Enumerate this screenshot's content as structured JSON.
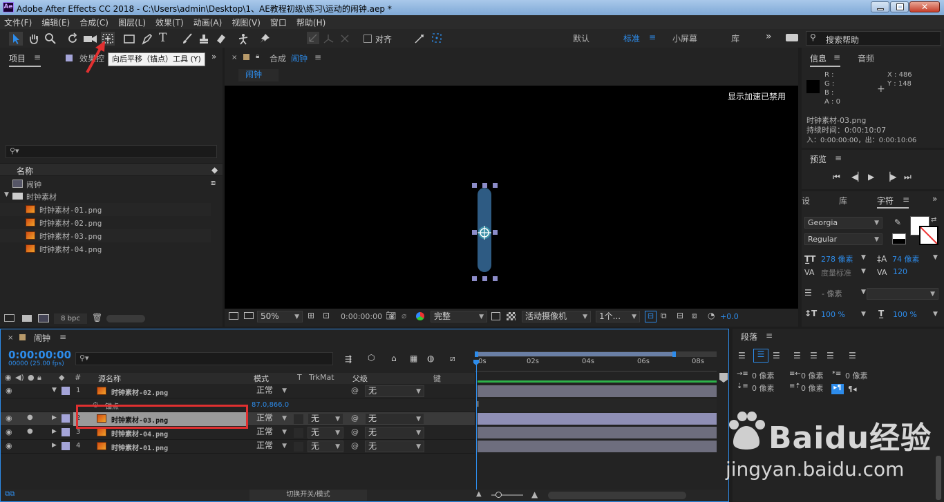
{
  "window": {
    "title": "Adobe After Effects CC 2018 - C:\\Users\\admin\\Desktop\\1、AE教程初级\\练习\\运动的闹钟.aep *",
    "app_icon": "Ae"
  },
  "menu": [
    "文件(F)",
    "编辑(E)",
    "合成(C)",
    "图层(L)",
    "效果(T)",
    "动画(A)",
    "视图(V)",
    "窗口",
    "帮助(H)"
  ],
  "toolbar": {
    "tooltip": "向后平移（锚点）工具 (Y)",
    "align_label": "对齐",
    "workspaces": [
      "默认",
      "标准",
      "小屏幕",
      "库"
    ],
    "search_placeholder": "搜索帮助"
  },
  "project": {
    "tab_project": "项目",
    "tab_effects": "效果控",
    "col_name": "名称",
    "items": [
      {
        "name": "闹钟",
        "type": "comp"
      },
      {
        "name": "时钟素材",
        "type": "folder"
      },
      {
        "name": "时钟素材-01.png",
        "type": "image"
      },
      {
        "name": "时钟素材-02.png",
        "type": "image"
      },
      {
        "name": "时钟素材-03.png",
        "type": "image"
      },
      {
        "name": "时钟素材-04.png",
        "type": "image"
      }
    ],
    "bpc": "8 bpc"
  },
  "comp": {
    "tab_prefix": "合成",
    "name": "闹钟",
    "breadcrumb": "闹钟",
    "accel_notice": "显示加速已禁用",
    "zoom": "50%",
    "timecode": "0:00:00:00",
    "quality": "完整",
    "camera": "活动摄像机",
    "views": "1个...",
    "exposure": "+0.0"
  },
  "info": {
    "tab_info": "信息",
    "tab_audio": "音频",
    "r": "R :",
    "g": "G :",
    "b": "B :",
    "a": "A : 0",
    "x": "X : 486",
    "y": "Y : 148",
    "file": "时钟素材-03.png",
    "duration": "持续时间：0:00:10:07",
    "inout": "入：0:00:00:00，出：0:00:10:06"
  },
  "preview": {
    "title": "预览"
  },
  "character": {
    "tab_settings": "设",
    "tab_library": "库",
    "tab_char": "字符",
    "font": "Georgia",
    "style": "Regular",
    "size": "278 像素",
    "leading": "74 像素",
    "kerning": "度量标准",
    "tracking": "120",
    "stroke_width": "- 像素",
    "vscale": "100 %",
    "hscale": "100 %"
  },
  "paragraph": {
    "title": "段落",
    "indent_left": "0 像素",
    "indent_first": "0 像素",
    "indent_right": "0 像素",
    "space_before": "0 像素",
    "space_after": "0 像素"
  },
  "timeline": {
    "comp_name": "闹钟",
    "timecode": "0:00:00:00",
    "fps": "00000 (25.00 fps)",
    "headers": {
      "num": "#",
      "source": "源名称",
      "mode": "模式",
      "t": "T",
      "trkmat": "TrkMat",
      "parent": "父级",
      "keys": "键"
    },
    "ruler": [
      "0s",
      "02s",
      "04s",
      "06s",
      "08s"
    ],
    "layers": [
      {
        "num": "1",
        "name": "时钟素材-02.png",
        "mode": "正常",
        "trkmat": "",
        "parent": "无",
        "expanded": true
      },
      {
        "num": "2",
        "name": "时钟素材-03.png",
        "mode": "正常",
        "trkmat": "无",
        "parent": "无",
        "selected": true
      },
      {
        "num": "3",
        "name": "时钟素材-04.png",
        "mode": "正常",
        "trkmat": "无",
        "parent": "无"
      },
      {
        "num": "4",
        "name": "时钟素材-01.png",
        "mode": "正常",
        "trkmat": "无",
        "parent": "无"
      }
    ],
    "prop_name": "锚点",
    "prop_value": "87.0,866.0",
    "footer_toggle": "切换开关/模式"
  },
  "watermark": {
    "brand": "Baidu经验",
    "url": "jingyan.baidu.com"
  },
  "colors": {
    "accent": "#2d8ceb",
    "highlight_red": "#e03030",
    "layer_swatch": "#a4a4d8"
  }
}
